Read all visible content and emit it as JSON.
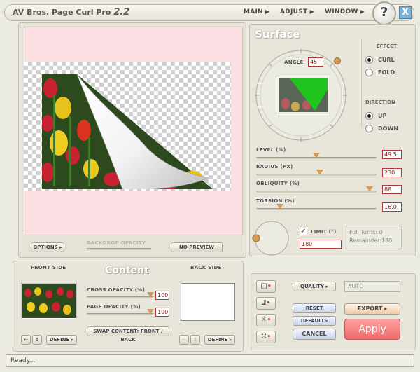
{
  "app": {
    "name": "AV Bros. Page Curl Pro",
    "version": "2.2"
  },
  "menu": [
    {
      "label": "MAIN"
    },
    {
      "label": "ADJUST"
    },
    {
      "label": "WINDOW"
    }
  ],
  "help_label": "?",
  "close_label": "X",
  "preview_panel": {
    "options_label": "OPTIONS",
    "backdrop_opacity_label": "BACKDROP OPACITY",
    "no_preview_label": "NO PREVIEW"
  },
  "surface": {
    "title": "Surface",
    "angle_label": "ANGLE",
    "angle_value": "45",
    "effect": {
      "title": "EFFECT",
      "options": [
        "CURL",
        "FOLD"
      ],
      "selected": "CURL"
    },
    "direction": {
      "title": "DIRECTION",
      "options": [
        "UP",
        "DOWN"
      ],
      "selected": "UP"
    },
    "sliders": [
      {
        "label": "LEVEL (%)",
        "value": "49.5",
        "fraction": 0.5
      },
      {
        "label": "RADIUS (PX)",
        "value": "230",
        "fraction": 0.53
      },
      {
        "label": "OBLIQUITY (%)",
        "value": "88",
        "fraction": 0.94
      },
      {
        "label": "TORSION (%)",
        "value": "16.0",
        "fraction": 0.2
      }
    ],
    "limit_label": "LIMIT (°)",
    "limit_checked": true,
    "limit_value": "180",
    "full_turns_label": "Full Turns:",
    "full_turns_value": "0",
    "remainder_label": "Remainder:",
    "remainder_value": "180"
  },
  "content": {
    "title": "Content",
    "front_side_label": "FRONT SIDE",
    "back_side_label": "BACK SIDE",
    "cross_opacity_label": "CROSS OPACITY (%)",
    "cross_opacity_value": "100",
    "page_opacity_label": "PAGE OPACITY (%)",
    "page_opacity_value": "100",
    "swap_label": "SWAP CONTENT: FRONT / BACK",
    "define_label": "DEFINE"
  },
  "actions": {
    "quality_label": "QUALITY",
    "quality_value": "AUTO",
    "reset_label": "RESET",
    "defaults_label": "DEFAULTS",
    "cancel_label": "CANCEL",
    "export_label": "EXPORT",
    "apply_label": "Apply"
  },
  "status_text": "Ready...",
  "colors": {
    "accent_red": "#b13636",
    "apply": "#f08080",
    "preview_bg": "#fbdfe2"
  }
}
